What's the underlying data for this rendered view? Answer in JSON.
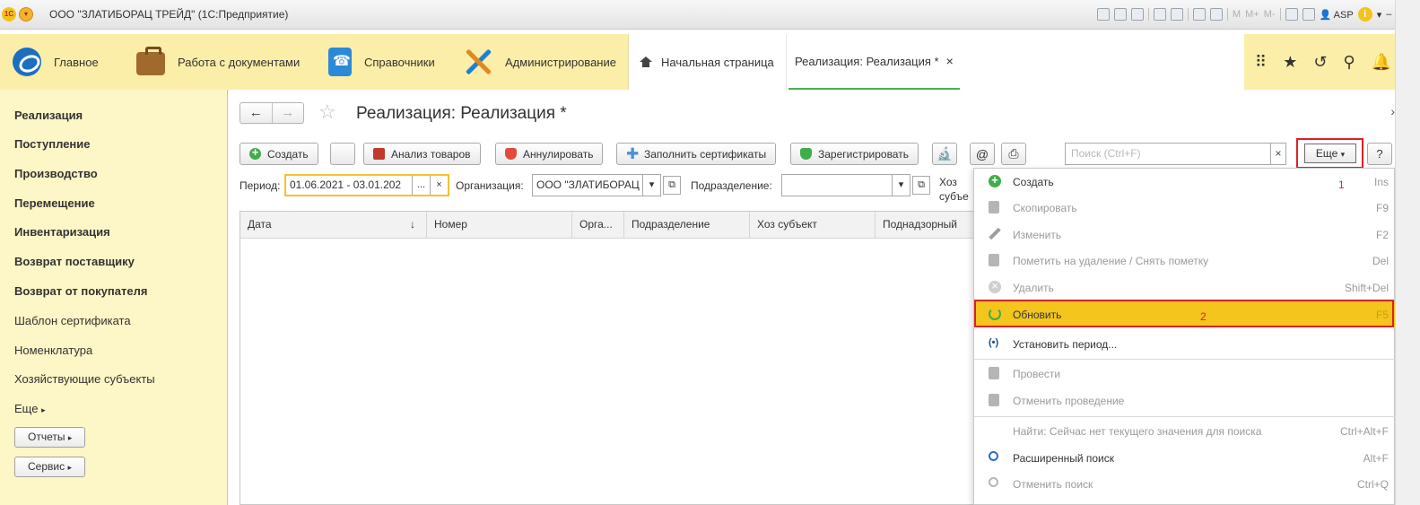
{
  "window": {
    "title": "ООО \"ЗЛАТИБОРАЦ ТРЕЙД\" (1С:Предприятие)",
    "logo": "1С",
    "toolbar_m": [
      "M",
      "M+",
      "M-"
    ],
    "user": "ASP"
  },
  "sections": [
    {
      "label": "Главное",
      "icon": "logo-icon"
    },
    {
      "label": "Работа с документами",
      "icon": "briefcase-icon"
    },
    {
      "label": "Справочники",
      "icon": "phonebook-icon"
    },
    {
      "label": "Администрирование",
      "icon": "tools-icon"
    }
  ],
  "tabs": [
    {
      "label": "Начальная страница",
      "icon": "home-icon"
    },
    {
      "label": "Реализация: Реализация *",
      "close": "×"
    }
  ],
  "left_nav": {
    "items": [
      "Реализация",
      "Поступление",
      "Производство",
      "Перемещение",
      "Инвентаризация",
      "Возврат поставщику",
      "Возврат от покупателя",
      "Шаблон сертификата",
      "Номенклатура",
      "Хозяйствующие субъекты",
      "Еще"
    ],
    "buttons": [
      "Отчеты",
      "Сервис"
    ]
  },
  "form": {
    "title": "Реализация: Реализация *",
    "buttons": {
      "create": "Создать",
      "analysis": "Анализ товаров",
      "annul": "Аннулировать",
      "fill_cert": "Заполнить сертификаты",
      "register": "Зарегистрировать",
      "more": "Еще",
      "help": "?"
    },
    "search_placeholder": "Поиск (Ctrl+F)",
    "filters": {
      "period_label": "Период:",
      "period_value": "01.06.2021 - 03.01.202",
      "period_btn": "...",
      "org_label": "Организация:",
      "org_value": "ООО \"ЗЛАТИБОРАЦ",
      "dept_label": "Подразделение:",
      "dept_value": "",
      "hoz_label_1": "Хоз",
      "hoz_label_2": "субъе"
    },
    "columns": [
      "Дата",
      "Номер",
      "Орга...",
      "Подразделение",
      "Хоз субъект",
      "Поднадзорный"
    ],
    "sort_indicator": "↓"
  },
  "menu": {
    "items": [
      {
        "label": "Создать",
        "key": "Ins",
        "disabled": false,
        "icon": "plus-icon"
      },
      {
        "label": "Скопировать",
        "key": "F9",
        "disabled": true,
        "icon": "copy-icon"
      },
      {
        "label": "Изменить",
        "key": "F2",
        "disabled": true,
        "icon": "pencil-icon"
      },
      {
        "label": "Пометить на удаление / Снять пометку",
        "key": "Del",
        "disabled": true,
        "icon": "mark-delete-icon"
      },
      {
        "label": "Удалить",
        "key": "Shift+Del",
        "disabled": true,
        "icon": "delete-icon"
      },
      {
        "label": "Обновить",
        "key": "F5",
        "disabled": false,
        "icon": "refresh-icon",
        "highlighted": true
      },
      {
        "label": "Установить период...",
        "key": "",
        "disabled": false,
        "icon": "period-icon"
      },
      {
        "label": "Провести",
        "key": "",
        "disabled": true,
        "icon": "post-icon"
      },
      {
        "label": "Отменить проведение",
        "key": "",
        "disabled": true,
        "icon": "unpost-icon"
      },
      {
        "label": "Найти: Сейчас нет текущего значения для поиска",
        "key": "Ctrl+Alt+F",
        "disabled": true,
        "icon": ""
      },
      {
        "label": "Расширенный поиск",
        "key": "Alt+F",
        "disabled": false,
        "icon": "search-icon"
      },
      {
        "label": "Отменить поиск",
        "key": "Ctrl+Q",
        "disabled": true,
        "icon": "cancel-search-icon"
      }
    ]
  },
  "annotations": {
    "one": "1",
    "two": "2"
  },
  "colors": {
    "section_bar": "#fbeea8",
    "left_panel": "#fdf6c7",
    "highlight": "#f4c51d",
    "annotation": "#e01f26",
    "active_tab": "#4caf50"
  }
}
